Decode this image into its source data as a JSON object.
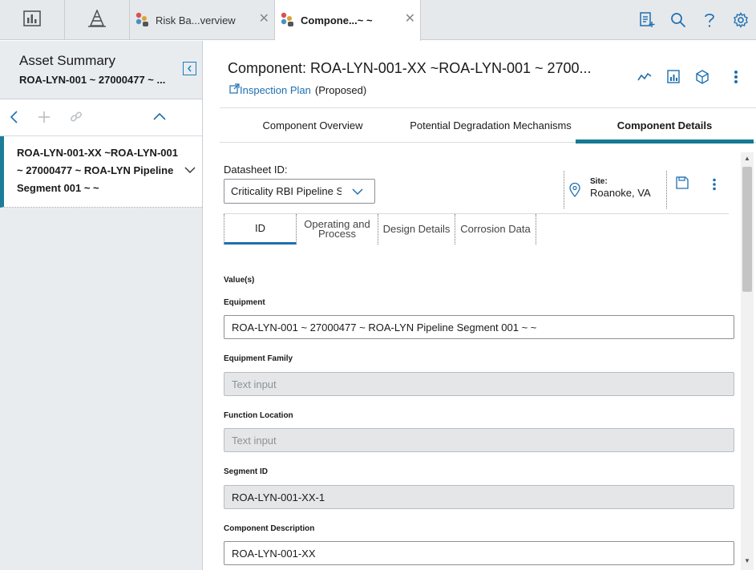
{
  "topbar": {
    "tabs": [
      {
        "label": "Risk Ba...verview",
        "close": "✕"
      },
      {
        "label": "Compone...~ ~",
        "close": "✕"
      }
    ]
  },
  "left_panel": {
    "title": "Asset Summary",
    "subtitle": "ROA-LYN-001 ~ 27000477 ~ ...",
    "item": "ROA-LYN-001-XX ~ROA-LYN-001 ~ 27000477 ~ ROA-LYN Pipeline Segment 001 ~ ~"
  },
  "main": {
    "title": "Component: ROA-LYN-001-XX ~ROA-LYN-001 ~ 2700...",
    "link": "Inspection Plan",
    "link_state": "(Proposed)",
    "tabs": [
      {
        "label": "Component Overview"
      },
      {
        "label": "Potential Degradation Mechanisms"
      },
      {
        "label": "Component Details"
      }
    ]
  },
  "datasheet": {
    "label": "Datasheet ID:",
    "selected": "Criticality RBI Pipeline Se",
    "site_label": "Site:",
    "site_value": "Roanoke, VA",
    "subtabs": [
      {
        "label": "ID"
      },
      {
        "label": "Operating and Process"
      },
      {
        "label": "Design Details"
      },
      {
        "label": "Corrosion Data"
      }
    ],
    "values_label": "Value(s)",
    "fields": [
      {
        "label": "Equipment",
        "value": "ROA-LYN-001 ~ 27000477 ~ ROA-LYN Pipeline Segment 001 ~  ~"
      },
      {
        "label": "Equipment Family",
        "placeholder": "Text input"
      },
      {
        "label": "Function Location",
        "placeholder": "Text input"
      },
      {
        "label": "Segment ID",
        "value": "ROA-LYN-001-XX-1"
      },
      {
        "label": "Component Description",
        "value": "ROA-LYN-001-XX"
      }
    ]
  },
  "colors": {
    "accent": "#157a94",
    "link": "#1d6fb0",
    "topbar_bg": "#e6e9ec",
    "disabled_field": "#e4e6e8"
  },
  "icons": [
    "dashboard-icon",
    "asset-hierarchy-icon",
    "risk-app-icon",
    "new-record-icon",
    "search-icon",
    "help-icon",
    "settings-icon",
    "collapse-left-icon",
    "back-icon",
    "add-icon",
    "link-icon",
    "chevron-up-icon",
    "chevron-down-icon",
    "external-link-icon",
    "trend-icon",
    "report-icon",
    "cube-icon",
    "more-vertical-icon",
    "location-pin-icon",
    "save-icon"
  ]
}
